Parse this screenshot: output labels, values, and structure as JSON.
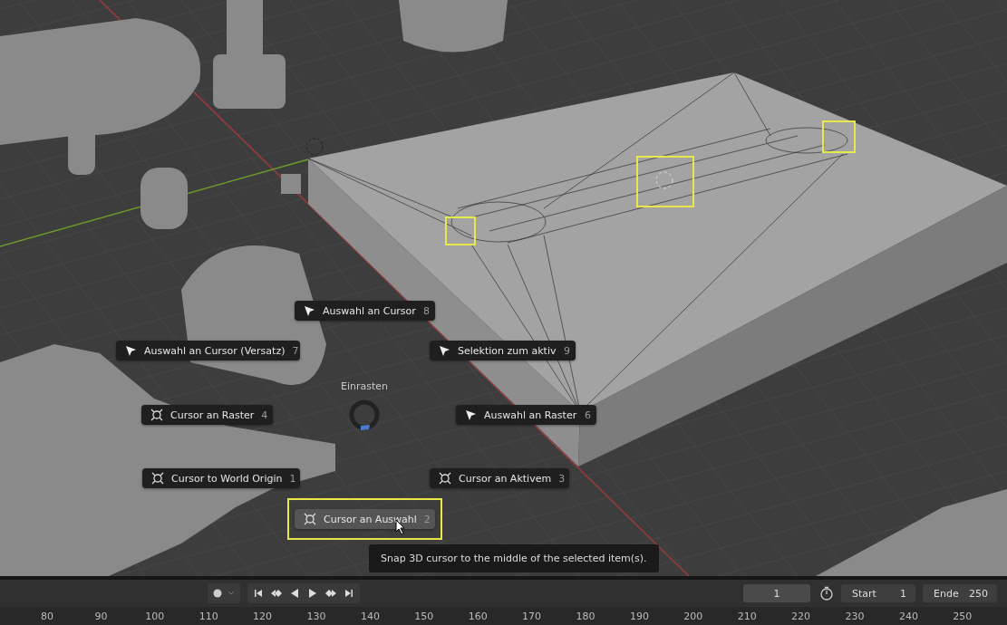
{
  "pie_menu": {
    "title": "Einrasten",
    "items": [
      {
        "label": "Auswahl an Cursor",
        "key": "8",
        "kind": "arrow",
        "selected": false
      },
      {
        "label": "Auswahl an Cursor (Versatz)",
        "key": "7",
        "kind": "arrow",
        "selected": false
      },
      {
        "label": "Selektion zum aktiv",
        "key": "9",
        "kind": "arrow",
        "selected": false
      },
      {
        "label": "Cursor an Raster",
        "key": "4",
        "kind": "crosshair",
        "selected": false
      },
      {
        "label": "Auswahl an Raster",
        "key": "6",
        "kind": "arrow",
        "selected": false
      },
      {
        "label": "Cursor to World Origin",
        "key": "1",
        "kind": "crosshair",
        "selected": false
      },
      {
        "label": "Cursor an Aktivem",
        "key": "3",
        "kind": "crosshair",
        "selected": false
      },
      {
        "label": "Cursor an Auswahl",
        "key": "2",
        "kind": "crosshair",
        "selected": true
      }
    ],
    "tooltip": "Snap 3D cursor to the middle of the selected item(s)."
  },
  "timeline": {
    "current_frame": "1",
    "start_label": "Start",
    "start": "1",
    "end_label": "Ende",
    "end": "250",
    "ruler": [
      "80",
      "90",
      "100",
      "110",
      "120",
      "130",
      "140",
      "150",
      "160",
      "170",
      "180",
      "190",
      "200",
      "210",
      "220",
      "230",
      "240",
      "250"
    ]
  }
}
